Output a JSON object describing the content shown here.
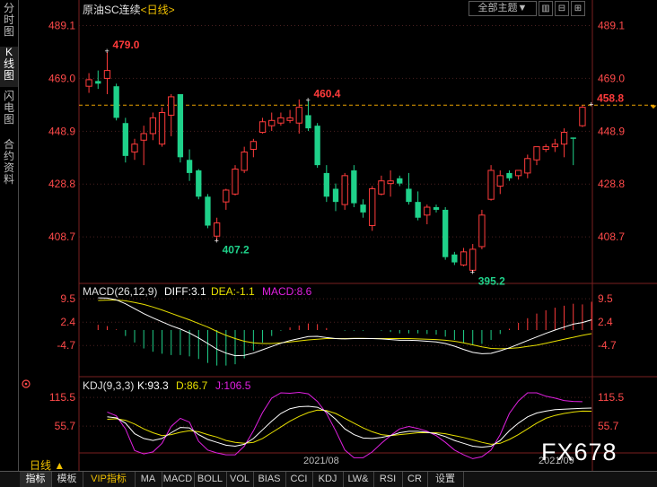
{
  "sidebar": [
    {
      "label": "分\n时\n图",
      "active": false
    },
    {
      "label": "K\n线\n图",
      "active": true
    },
    {
      "label": "闪\n电\n图",
      "active": false
    },
    {
      "label": "合\n约\n资\n料",
      "active": false
    }
  ],
  "header": {
    "title": "原油SC连续",
    "period": "<日线>"
  },
  "toolbar": {
    "theme": "全部主题▼",
    "b1": "▥",
    "b2": "⊟",
    "b3": "⊞"
  },
  "macd": {
    "title": "MACD(26,12,9)",
    "diff": "DIFF:3.1",
    "dea": "DEA:-1.1",
    "macd": "MACD:8.6"
  },
  "kdj": {
    "title": "KDJ(9,3,3)",
    "k": "K:93.3",
    "d": "D:86.7",
    "j": "J:106.5"
  },
  "date_label": "2021/08",
  "date_label_2": "2021/09",
  "period_label": "日线 ▲",
  "watermark": "FX678",
  "tabs": [
    {
      "label": "指标",
      "active": true,
      "vip": false
    },
    {
      "label": "模板",
      "active": false,
      "vip": false
    },
    {
      "label": "VIP指标",
      "active": false,
      "vip": true
    },
    {
      "label": "MA",
      "active": false,
      "vip": false
    },
    {
      "label": "MACD",
      "active": false,
      "vip": false
    },
    {
      "label": "BOLL",
      "active": false,
      "vip": false
    },
    {
      "label": "VOL",
      "active": false,
      "vip": false
    },
    {
      "label": "BIAS",
      "active": false,
      "vip": false
    },
    {
      "label": "CCI",
      "active": false,
      "vip": false
    },
    {
      "label": "KDJ",
      "active": false,
      "vip": false
    },
    {
      "label": "LW&",
      "active": false,
      "vip": false
    },
    {
      "label": "RSI",
      "active": false,
      "vip": false
    },
    {
      "label": "CR",
      "active": false,
      "vip": false
    },
    {
      "label": "设置",
      "active": false,
      "vip": false
    }
  ],
  "colors": {
    "up": "#ff3b3b",
    "down": "#1fd18a",
    "axis": "#ff4a4a",
    "grid": "#4a2020",
    "diff": "#ffffff",
    "dea": "#e8e000",
    "j": "#e020e0",
    "refline": "#e8a000"
  },
  "chart_data": [
    {
      "type": "candlestick",
      "title": "原油SC连续 <日线>",
      "yticks": [
        489.1,
        469.0,
        448.9,
        428.8,
        408.7
      ],
      "ylim": [
        391,
        492
      ],
      "reference_line": 458.8,
      "annotations": [
        {
          "label": "479.0",
          "index": 2,
          "value": 479.0
        },
        {
          "label": "407.2",
          "index": 14,
          "value": 407.2
        },
        {
          "label": "460.4",
          "index": 24,
          "value": 460.4
        },
        {
          "label": "395.2",
          "index": 42,
          "value": 395.2
        },
        {
          "label": "458.8",
          "index": 55,
          "value": 458.8
        }
      ],
      "candles": [
        {
          "o": 466.0,
          "h": 471.0,
          "l": 463.5,
          "c": 468.5
        },
        {
          "o": 468.0,
          "h": 472.0,
          "l": 465.0,
          "c": 467.0
        },
        {
          "o": 469.0,
          "h": 479.0,
          "l": 463.0,
          "c": 472.0
        },
        {
          "o": 466.0,
          "h": 467.0,
          "l": 453.0,
          "c": 454.0
        },
        {
          "o": 452.0,
          "h": 454.0,
          "l": 437.0,
          "c": 439.5
        },
        {
          "o": 441.0,
          "h": 446.0,
          "l": 438.0,
          "c": 444.0
        },
        {
          "o": 445.5,
          "h": 451.0,
          "l": 436.0,
          "c": 448.0
        },
        {
          "o": 448.0,
          "h": 456.0,
          "l": 445.5,
          "c": 454.0
        },
        {
          "o": 444.0,
          "h": 458.0,
          "l": 443.0,
          "c": 456.0
        },
        {
          "o": 455.0,
          "h": 463.0,
          "l": 447.0,
          "c": 462.0
        },
        {
          "o": 463.0,
          "h": 463.0,
          "l": 437.0,
          "c": 439.0
        },
        {
          "o": 438.0,
          "h": 442.0,
          "l": 430.0,
          "c": 433.0
        },
        {
          "o": 434.0,
          "h": 434.5,
          "l": 423.0,
          "c": 424.0
        },
        {
          "o": 424.0,
          "h": 425.0,
          "l": 412.0,
          "c": 413.0
        },
        {
          "o": 409.0,
          "h": 416.0,
          "l": 407.2,
          "c": 414.0
        },
        {
          "o": 422.0,
          "h": 427.0,
          "l": 419.0,
          "c": 426.5
        },
        {
          "o": 425.0,
          "h": 436.0,
          "l": 424.5,
          "c": 434.5
        },
        {
          "o": 434.0,
          "h": 443.0,
          "l": 433.0,
          "c": 441.0
        },
        {
          "o": 442.0,
          "h": 446.0,
          "l": 439.0,
          "c": 445.0
        },
        {
          "o": 448.5,
          "h": 454.0,
          "l": 448.0,
          "c": 452.5
        },
        {
          "o": 451.0,
          "h": 456.0,
          "l": 449.0,
          "c": 453.0
        },
        {
          "o": 452.0,
          "h": 456.0,
          "l": 451.0,
          "c": 454.0
        },
        {
          "o": 453.0,
          "h": 457.0,
          "l": 452.0,
          "c": 454.0
        },
        {
          "o": 452.0,
          "h": 461.0,
          "l": 448.0,
          "c": 458.0
        },
        {
          "o": 455.0,
          "h": 460.4,
          "l": 449.0,
          "c": 450.0
        },
        {
          "o": 451.0,
          "h": 452.0,
          "l": 435.0,
          "c": 436.0
        },
        {
          "o": 433.0,
          "h": 436.0,
          "l": 422.0,
          "c": 424.0
        },
        {
          "o": 427.0,
          "h": 429.0,
          "l": 418.5,
          "c": 422.0
        },
        {
          "o": 421.0,
          "h": 433.0,
          "l": 419.0,
          "c": 432.0
        },
        {
          "o": 434.0,
          "h": 436.0,
          "l": 420.0,
          "c": 421.5
        },
        {
          "o": 421.0,
          "h": 423.0,
          "l": 416.0,
          "c": 418.0
        },
        {
          "o": 413.0,
          "h": 428.0,
          "l": 411.0,
          "c": 427.0
        },
        {
          "o": 425.0,
          "h": 432.0,
          "l": 424.5,
          "c": 430.0
        },
        {
          "o": 429.0,
          "h": 434.0,
          "l": 424.0,
          "c": 430.0
        },
        {
          "o": 431.0,
          "h": 432.0,
          "l": 428.0,
          "c": 429.0
        },
        {
          "o": 427.0,
          "h": 433.0,
          "l": 421.0,
          "c": 422.0
        },
        {
          "o": 422.0,
          "h": 426.0,
          "l": 415.0,
          "c": 416.0
        },
        {
          "o": 417.0,
          "h": 421.0,
          "l": 413.5,
          "c": 420.0
        },
        {
          "o": 420.0,
          "h": 421.0,
          "l": 418.0,
          "c": 419.0
        },
        {
          "o": 419.0,
          "h": 420.0,
          "l": 400.0,
          "c": 401.0
        },
        {
          "o": 402.0,
          "h": 403.0,
          "l": 398.0,
          "c": 399.0
        },
        {
          "o": 398.0,
          "h": 404.5,
          "l": 397.5,
          "c": 403.0
        },
        {
          "o": 396.0,
          "h": 406.0,
          "l": 395.2,
          "c": 404.0
        },
        {
          "o": 405.0,
          "h": 419.0,
          "l": 404.0,
          "c": 417.0
        },
        {
          "o": 423.0,
          "h": 436.0,
          "l": 422.5,
          "c": 434.0
        },
        {
          "o": 428.0,
          "h": 434.0,
          "l": 425.0,
          "c": 432.0
        },
        {
          "o": 433.0,
          "h": 434.0,
          "l": 430.0,
          "c": 431.0
        },
        {
          "o": 432.0,
          "h": 434.0,
          "l": 430.5,
          "c": 434.0
        },
        {
          "o": 433.0,
          "h": 440.0,
          "l": 431.0,
          "c": 438.5
        },
        {
          "o": 438.0,
          "h": 443.0,
          "l": 436.0,
          "c": 443.0
        },
        {
          "o": 442.0,
          "h": 444.0,
          "l": 441.0,
          "c": 443.0
        },
        {
          "o": 443.0,
          "h": 446.0,
          "l": 441.0,
          "c": 444.0
        },
        {
          "o": 444.0,
          "h": 450.0,
          "l": 439.0,
          "c": 448.5
        },
        {
          "o": 446.5,
          "h": 446.5,
          "l": 436.0,
          "c": 446.0
        },
        {
          "o": 451.0,
          "h": 458.8,
          "l": 450.5,
          "c": 458.0
        }
      ]
    },
    {
      "type": "macd",
      "yticks": [
        9.5,
        2.4,
        -4.7
      ],
      "ylim": [
        -12,
        12
      ],
      "diff": [
        9.8,
        9.7,
        9.2,
        8.0,
        6.5,
        5.0,
        3.7,
        2.5,
        1.3,
        0.3,
        -0.9,
        -2.4,
        -4.1,
        -5.8,
        -7.0,
        -7.8,
        -7.7,
        -7.0,
        -6.0,
        -5.0,
        -4.0,
        -3.2,
        -2.6,
        -2.0,
        -1.9,
        -2.3,
        -2.6,
        -2.7,
        -2.6,
        -2.6,
        -2.6,
        -2.7,
        -2.9,
        -3.1,
        -3.1,
        -3.2,
        -3.4,
        -3.6,
        -4.1,
        -4.9,
        -5.9,
        -6.8,
        -7.2,
        -7.1,
        -6.3,
        -5.4,
        -4.3,
        -3.2,
        -2.1,
        -1.0,
        0.0,
        0.9,
        1.8,
        2.3,
        3.1
      ],
      "dea": [
        9.0,
        9.1,
        9.1,
        8.9,
        8.4,
        7.8,
        7.0,
        6.1,
        5.1,
        4.1,
        3.1,
        2.0,
        0.9,
        -0.4,
        -1.6,
        -2.6,
        -3.4,
        -3.9,
        -4.1,
        -4.1,
        -3.9,
        -3.6,
        -3.3,
        -3.0,
        -2.8,
        -2.6,
        -2.6,
        -2.6,
        -2.5,
        -2.5,
        -2.6,
        -2.6,
        -2.6,
        -2.6,
        -2.6,
        -2.7,
        -2.8,
        -2.9,
        -3.1,
        -3.4,
        -3.9,
        -4.5,
        -5.1,
        -5.6,
        -5.7,
        -5.6,
        -5.4,
        -5.0,
        -4.6,
        -4.0,
        -3.4,
        -2.8,
        -2.2,
        -1.6,
        -1.1
      ],
      "macd": [
        1.6,
        1.2,
        0.2,
        -1.8,
        -3.8,
        -5.6,
        -6.6,
        -7.2,
        -7.6,
        -7.6,
        -8.0,
        -8.8,
        -10.0,
        -10.8,
        -10.8,
        -10.4,
        -8.6,
        -6.2,
        -3.8,
        -1.8,
        -0.2,
        0.8,
        1.4,
        2.0,
        1.8,
        0.6,
        0.0,
        -0.2,
        -0.2,
        -0.2,
        0.0,
        -0.2,
        -0.6,
        -1.0,
        -1.0,
        -1.0,
        -1.2,
        -1.4,
        -2.0,
        -3.0,
        -4.0,
        -4.6,
        -4.2,
        -3.0,
        -1.2,
        0.4,
        2.2,
        3.6,
        5.0,
        6.0,
        6.8,
        7.4,
        8.0,
        7.8,
        8.6
      ]
    },
    {
      "type": "kdj",
      "yticks": [
        115.5,
        55.7
      ],
      "ylim": [
        0,
        125
      ],
      "k": [
        75,
        73,
        62,
        40,
        30,
        26,
        30,
        42,
        53,
        52,
        38,
        28,
        22,
        16,
        14,
        18,
        30,
        48,
        66,
        82,
        92,
        96,
        97,
        95,
        86,
        70,
        50,
        38,
        31,
        30,
        32,
        36,
        42,
        45,
        45,
        43,
        40,
        34,
        26,
        20,
        14,
        12,
        14,
        26,
        46,
        62,
        75,
        83,
        87,
        90,
        91,
        92,
        93,
        93.3
      ],
      "d": [
        70,
        71,
        68,
        60,
        50,
        42,
        36,
        38,
        43,
        46,
        44,
        38,
        33,
        26,
        22,
        20,
        22,
        30,
        42,
        54,
        66,
        76,
        84,
        89,
        88,
        82,
        72,
        62,
        52,
        44,
        38,
        36,
        38,
        40,
        42,
        42,
        42,
        40,
        36,
        32,
        27,
        22,
        18,
        20,
        28,
        38,
        50,
        62,
        72,
        78,
        82,
        85,
        87,
        86.7
      ],
      "j": [
        85,
        77,
        50,
        5,
        -2,
        2,
        20,
        55,
        72,
        64,
        24,
        6,
        0,
        -4,
        -4,
        14,
        46,
        84,
        114,
        125,
        124,
        126,
        123,
        107,
        82,
        46,
        6,
        -10,
        -10,
        2,
        20,
        36,
        50,
        55,
        51,
        45,
        36,
        22,
        6,
        -4,
        -12,
        -8,
        6,
        38,
        82,
        108,
        125,
        125,
        118,
        114,
        109,
        107,
        106.5
      ]
    }
  ]
}
